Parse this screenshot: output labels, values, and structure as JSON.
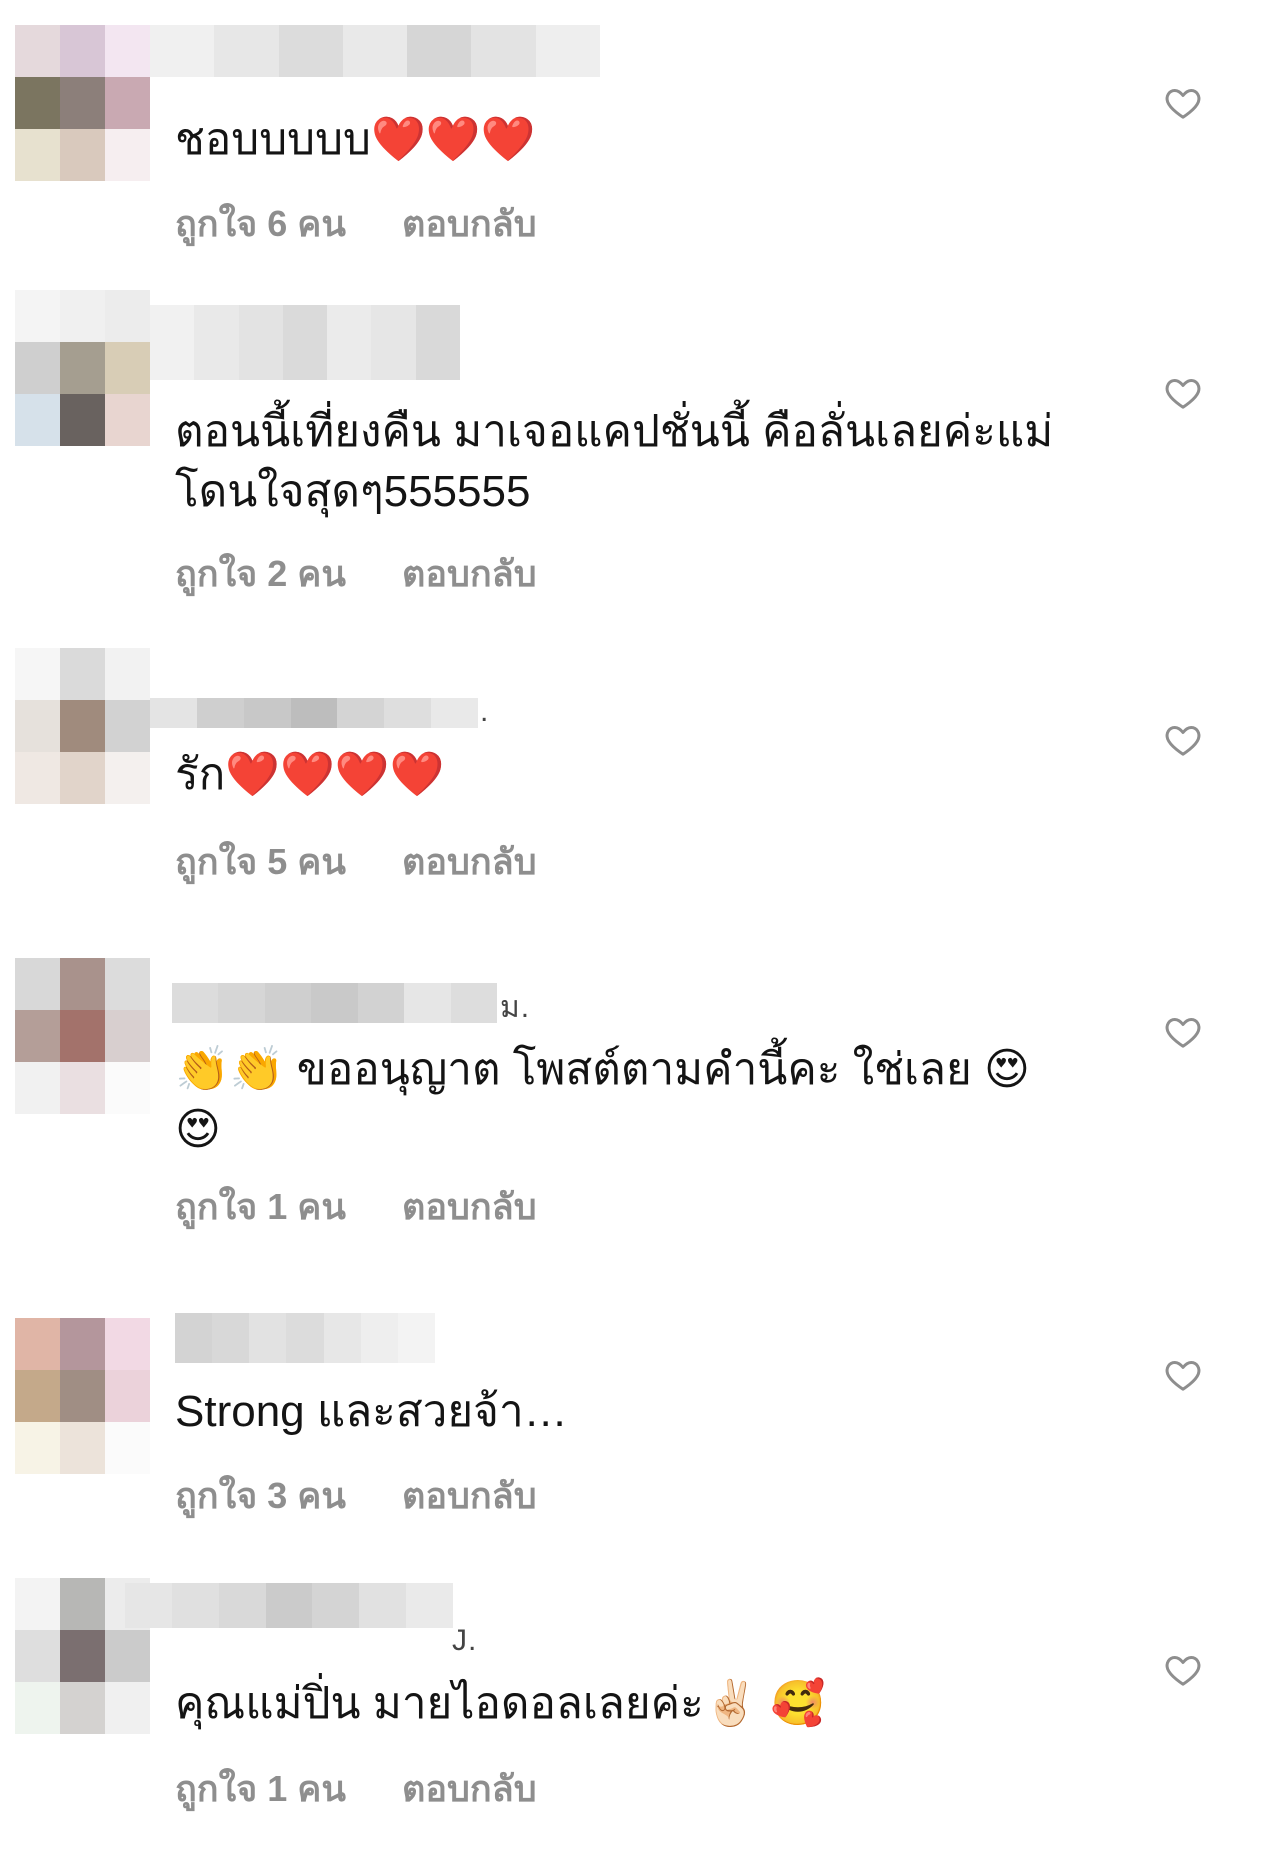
{
  "comments": [
    {
      "text": "ชอบบบบบ❤️❤️❤️",
      "likes": "ถูกใจ 6 คน",
      "reply": "ตอบกลับ",
      "name_suffix": "",
      "avatar_colors": [
        "#e5d9dc",
        "#d8c6d6",
        "#f3e6f1",
        "#7b7560",
        "#8c7f7a",
        "#c9a9b2",
        "#e7e1cf",
        "#d9c9bd",
        "#f6eef0"
      ],
      "name_colors": [
        "#f0f0f0",
        "#e7e7e7",
        "#dcdcdc",
        "#e9e9e9",
        "#d6d6d6",
        "#e3e3e3",
        "#eeeeee"
      ]
    },
    {
      "text": "ตอนนี้เที่ยงคืน มาเจอแคปชั่นนี้ คือลั่นเลยค่ะแม่ โดนใจสุดๆ555555",
      "likes": "ถูกใจ 2 คน",
      "reply": "ตอบกลับ",
      "name_suffix": "",
      "avatar_colors": [
        "#f4f4f4",
        "#f0f0f0",
        "#ececec",
        "#cfcfcf",
        "#a59e90",
        "#d8cdb6",
        "#d6e1ea",
        "#69625f",
        "#e8d5d0"
      ],
      "name_colors": [
        "#f1f1f1",
        "#e9e9e9",
        "#e3e3e3",
        "#dadada",
        "#ebebeb",
        "#e6e6e6",
        "#d9d9d9"
      ]
    },
    {
      "text": "รัก❤️❤️❤️❤️",
      "likes": "ถูกใจ 5 คน",
      "reply": "ตอบกลับ",
      "name_suffix": ".",
      "avatar_colors": [
        "#f6f6f6",
        "#dadada",
        "#f2f2f2",
        "#e6e1dc",
        "#a08b7d",
        "#d2d2d2",
        "#efe8e3",
        "#e1d4ca",
        "#f4f0ee"
      ],
      "name_colors": [
        "#e4e4e4",
        "#cfcfcf",
        "#c8c8c8",
        "#bdbdbd",
        "#d4d4d4",
        "#dedede",
        "#e9e9e9"
      ]
    },
    {
      "text": "👏👏 ขออนุญาต โพสต์ตามคำนี้คะ ใช่เลย 😍😍",
      "likes": "ถูกใจ 1 คน",
      "reply": "ตอบกลับ",
      "name_suffix": "ม.",
      "avatar_colors": [
        "#d8d8d8",
        "#a9928c",
        "#dcdcdc",
        "#b49e98",
        "#a3726b",
        "#d8cfcf",
        "#f1f1f1",
        "#eadfe1",
        "#fbfbfb"
      ],
      "name_colors": [
        "#dcdcdc",
        "#d6d6d6",
        "#cfcfcf",
        "#c9c9c9",
        "#d2d2d2",
        "#e6e6e6",
        "#dddddd"
      ]
    },
    {
      "text": "Strong และสวยจ้า…",
      "likes": "ถูกใจ 3 คน",
      "reply": "ตอบกลับ",
      "name_suffix": "",
      "avatar_colors": [
        "#e0b5a6",
        "#b4969c",
        "#f2d9e4",
        "#c4a98a",
        "#a08e84",
        "#ebd2da",
        "#f7f3e6",
        "#ece3da",
        "#fbfbfb"
      ],
      "name_colors": [
        "#d3d3d3",
        "#d8d8d8",
        "#e2e2e2",
        "#dcdcdc",
        "#e7e7e7",
        "#eeeeee",
        "#f3f3f3"
      ]
    },
    {
      "text": "คุณแม่ปิ่น มายไอดอลเลยค่ะ✌🏻 🥰",
      "likes": "ถูกใจ 1 คน",
      "reply": "ตอบกลับ",
      "name_suffix": "J.",
      "avatar_colors": [
        "#f3f3f3",
        "#b7b7b5",
        "#ececec",
        "#dedede",
        "#7b6f70",
        "#cbcbcb",
        "#eef4ee",
        "#d4d2d0",
        "#f0f0f0"
      ],
      "name_colors": [
        "#e6e6e6",
        "#e0e0e0",
        "#d9d9d9",
        "#cbcbcb",
        "#d4d4d4",
        "#e1e1e1",
        "#eaeaea"
      ]
    }
  ]
}
